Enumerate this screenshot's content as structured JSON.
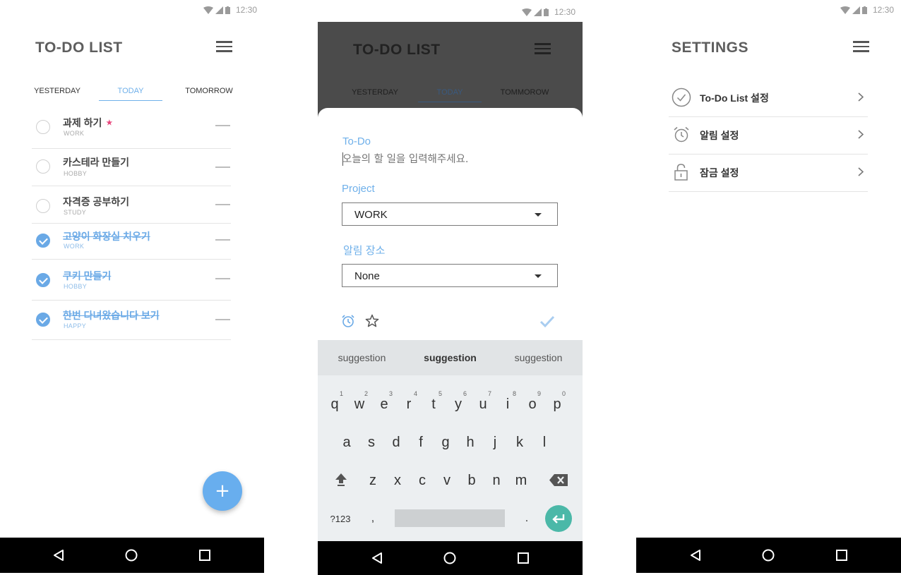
{
  "status": {
    "time": "12:30"
  },
  "screen1": {
    "title": "TO-DO LIST",
    "tabs": [
      "YESTERDAY",
      "TODAY",
      "TOMORROW"
    ],
    "active_tab": "TODAY",
    "items": [
      {
        "name": "과제 하기",
        "category": "WORK",
        "done": false,
        "starred": true,
        "star": "★"
      },
      {
        "name": "카스테라 만들기",
        "category": "HOBBY",
        "done": false,
        "starred": false
      },
      {
        "name": "자격증 공부하기",
        "category": "STUDY",
        "done": false,
        "starred": false
      },
      {
        "name": "고양이 화장실 치우기",
        "category": "WORK",
        "done": true,
        "starred": false
      },
      {
        "name": "쿠키 만들기",
        "category": "HOBBY",
        "done": true,
        "starred": false
      },
      {
        "name": "한번 다녀왔습니다 보기",
        "category": "HAPPY",
        "done": true,
        "starred": false
      }
    ],
    "fab_label": "+"
  },
  "screen2": {
    "title": "TO-DO LIST",
    "tabs": [
      "YESTERDAY",
      "TODAY",
      "TOMMOROW"
    ],
    "active_tab": "TODAY",
    "todo_label": "To-Do",
    "todo_placeholder": "오늘의 할 일을 입력해주세요.",
    "project_label": "Project",
    "project_value": "WORK",
    "alarm_label": "알림 장소",
    "alarm_value": "None",
    "suggestions": [
      "suggestion",
      "suggestion",
      "suggestion"
    ],
    "keys_row1": [
      "q",
      "w",
      "e",
      "r",
      "t",
      "y",
      "u",
      "i",
      "o",
      "p"
    ],
    "hints_row1": [
      "1",
      "2",
      "3",
      "4",
      "5",
      "6",
      "7",
      "8",
      "9",
      "0"
    ],
    "keys_row2": [
      "a",
      "s",
      "d",
      "f",
      "g",
      "h",
      "j",
      "k",
      "l"
    ],
    "keys_row3": [
      "z",
      "x",
      "c",
      "v",
      "b",
      "n",
      "m"
    ],
    "key_symbols": "?123",
    "key_comma": ",",
    "key_period": "."
  },
  "screen3": {
    "title": "SETTINGS",
    "rows": [
      "To-Do List 설정",
      "알림 설정",
      "잠금 설정"
    ]
  },
  "colors": {
    "accent": "#6aa9e6",
    "star": "#e8467c",
    "enter": "#4bb8a8",
    "overlay": "#4b4b4b"
  }
}
